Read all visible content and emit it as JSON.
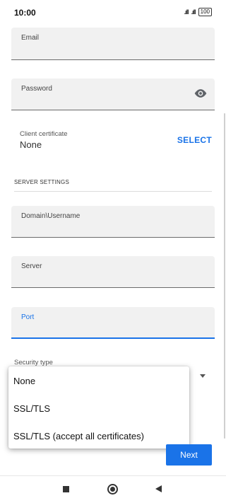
{
  "status_bar": {
    "time": "10:00",
    "signal1": ".ıll",
    "signal2": ".ıll",
    "battery": "100"
  },
  "form": {
    "email_label": "Email",
    "password_label": "Password",
    "client_certificate_label": "Client certificate",
    "client_certificate_value": "None",
    "select_label": "SELECT",
    "server_settings_header": "SERVER SETTINGS",
    "domain_username_label": "Domain\\Username",
    "server_label": "Server",
    "port_label": "Port",
    "security_type_label": "Security type"
  },
  "security_dropdown": {
    "options": [
      "None",
      "SSL/TLS",
      "SSL/TLS (accept all certificates)"
    ]
  },
  "next_label": "Next",
  "colors": {
    "accent": "#1a73e8",
    "field_bg": "#f1f1f1"
  }
}
